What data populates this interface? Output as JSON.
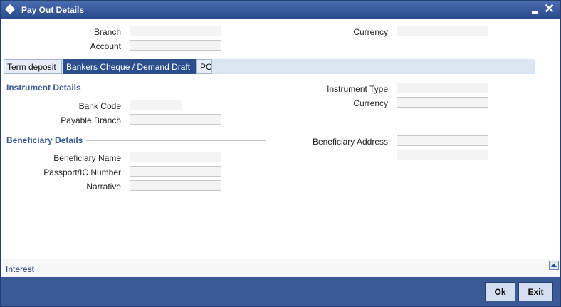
{
  "window": {
    "title": "Pay Out Details"
  },
  "header": {
    "branch_label": "Branch",
    "branch_value": "",
    "account_label": "Account",
    "account_value": "",
    "currency_label": "Currency",
    "currency_value": ""
  },
  "tabs": [
    {
      "label": "Term deposit",
      "active": false
    },
    {
      "label": "Bankers Cheque / Demand Draft",
      "active": true
    },
    {
      "label": "PC",
      "active": false
    }
  ],
  "instrument": {
    "section_title": "Instrument Details",
    "bank_code_label": "Bank Code",
    "bank_code_value": "",
    "payable_branch_label": "Payable Branch",
    "payable_branch_value": "",
    "instrument_type_label": "Instrument Type",
    "instrument_type_value": "",
    "currency_label": "Currency",
    "currency_value": ""
  },
  "beneficiary": {
    "section_title": "Beneficiary Details",
    "name_label": "Beneficiary Name",
    "name_value": "",
    "passport_label": "Passport/IC Number",
    "passport_value": "",
    "narrative_label": "Narrative",
    "narrative_value": "",
    "address_label": "Beneficiary Address",
    "address_line1": "",
    "address_line2": ""
  },
  "bottom": {
    "interest_link": "Interest"
  },
  "footer": {
    "ok_label": "Ok",
    "exit_label": "Exit"
  },
  "colors": {
    "titlebar": "#28498a",
    "active_tab": "#2b4f8c",
    "section": "#3b5a8e",
    "footer": "#3a5a96"
  }
}
